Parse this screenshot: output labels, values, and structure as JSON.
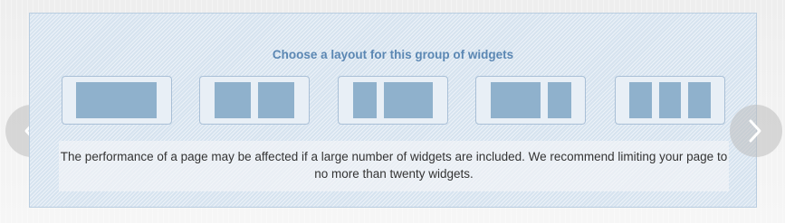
{
  "layout_picker": {
    "heading": "Choose a layout for this group of widgets",
    "options": [
      {
        "icon": "layout-single-icon"
      },
      {
        "icon": "layout-two-equal-icon"
      },
      {
        "icon": "layout-narrow-wide-icon"
      },
      {
        "icon": "layout-wide-narrow-icon"
      },
      {
        "icon": "layout-three-equal-icon"
      }
    ],
    "notice": "The performance of a page may be affected if a large number of widgets are included. We recommend limiting your page to no more than twenty widgets."
  },
  "carousel": {
    "prev_icon": "chevron-left-icon",
    "next_icon": "chevron-right-icon"
  },
  "colors": {
    "panel_background": "#d6e3ef",
    "heading": "#5b87b3",
    "layout_block": "#8fb1cc",
    "option_background": "#e8eff6"
  }
}
